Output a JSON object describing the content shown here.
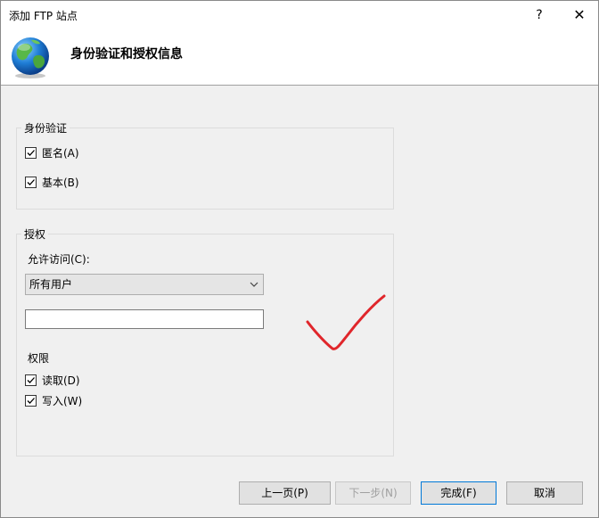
{
  "window": {
    "title": "添加 FTP 站点",
    "help_glyph": "?",
    "close_glyph": "✕"
  },
  "header": {
    "heading": "身份验证和授权信息",
    "icon": "globe-icon"
  },
  "authentication": {
    "group_label": "身份验证",
    "anonymous": {
      "label": "匿名(A)",
      "checked": true
    },
    "basic": {
      "label": "基本(B)",
      "checked": true
    }
  },
  "authorization": {
    "group_label": "授权",
    "allow_access_label": "允许访问(C):",
    "allow_access_selected": "所有用户",
    "input_value": "",
    "permissions_label": "权限",
    "read": {
      "label": "读取(D)",
      "checked": true
    },
    "write": {
      "label": "写入(W)",
      "checked": true
    }
  },
  "annotation": {
    "kind": "red-handdrawn-checkmark",
    "color": "#e0262b"
  },
  "buttons": {
    "previous": "上一页(P)",
    "next": "下一步(N)",
    "finish": "完成(F)",
    "cancel": "取消"
  },
  "colors": {
    "window_bg": "#f0f0f0",
    "accent_border": "#0078d7"
  }
}
